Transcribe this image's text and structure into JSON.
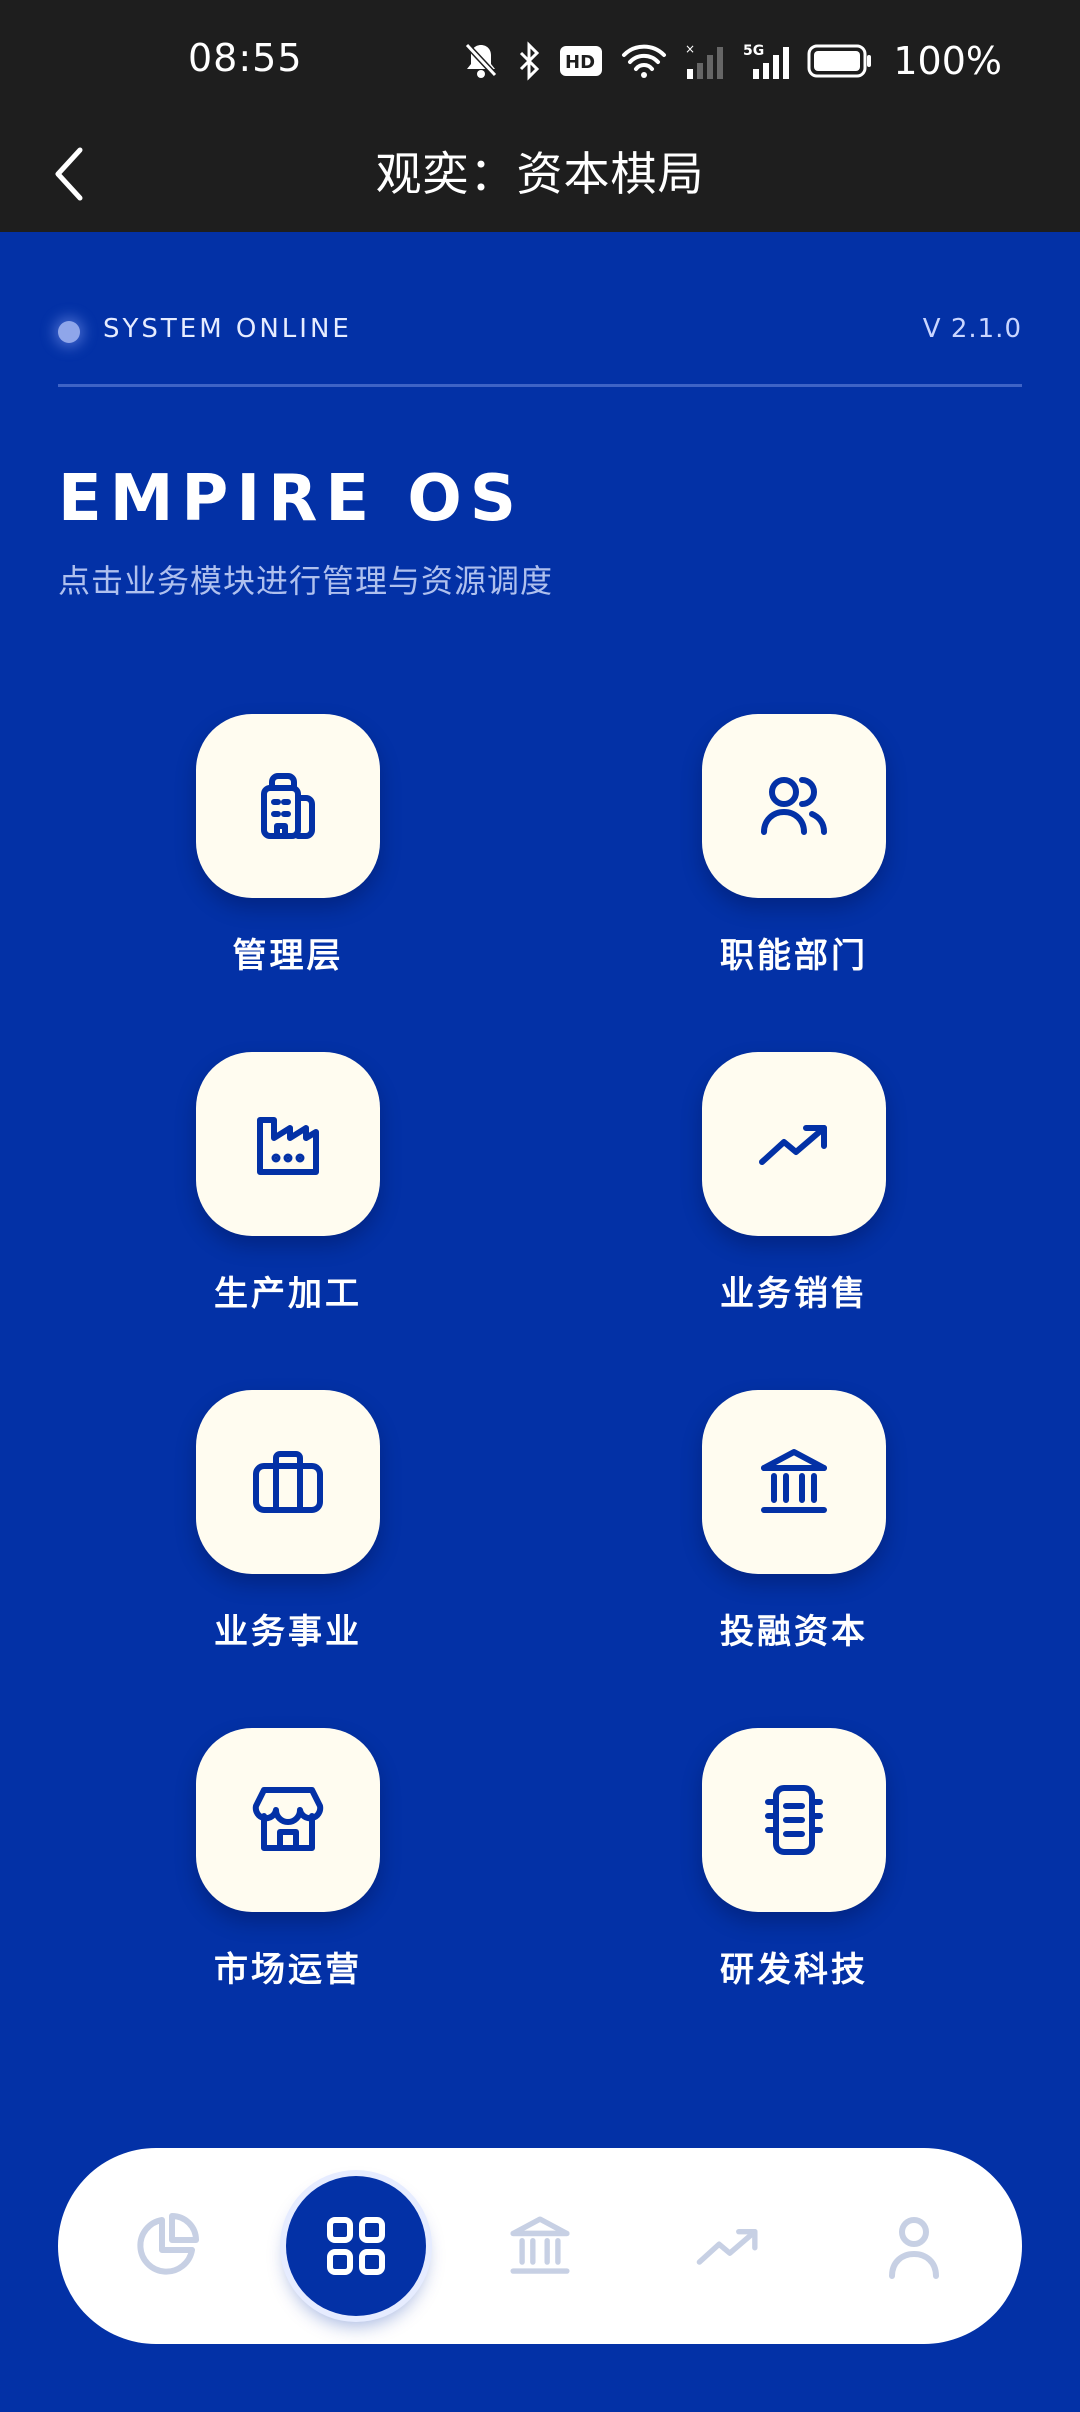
{
  "status_bar": {
    "time": "08:55",
    "battery": "100%",
    "icons": [
      "bell-muted-icon",
      "bluetooth-icon",
      "hd-icon",
      "wifi-icon",
      "signal-weak-icon",
      "signal-5g-icon",
      "battery-icon"
    ]
  },
  "header": {
    "title": "观奕：资本棋局",
    "back_icon": "chevron-left-icon"
  },
  "system": {
    "status": "SYSTEM ONLINE",
    "version": "V 2.1.0"
  },
  "main": {
    "title": "EMPIRE OS",
    "subtitle": "点击业务模块进行管理与资源调度",
    "modules": [
      {
        "label": "管理层",
        "icon": "building-icon"
      },
      {
        "label": "职能部门",
        "icon": "users-icon"
      },
      {
        "label": "生产加工",
        "icon": "factory-icon"
      },
      {
        "label": "业务销售",
        "icon": "trending-up-icon"
      },
      {
        "label": "业务事业",
        "icon": "briefcase-icon"
      },
      {
        "label": "投融资本",
        "icon": "bank-icon"
      },
      {
        "label": "市场运营",
        "icon": "store-icon"
      },
      {
        "label": "研发科技",
        "icon": "chip-icon"
      }
    ]
  },
  "bottom_nav": {
    "items": [
      {
        "icon": "pie-chart-icon",
        "active": false
      },
      {
        "icon": "grid-icon",
        "active": true
      },
      {
        "icon": "bank-icon",
        "active": false
      },
      {
        "icon": "trending-up-icon",
        "active": false
      },
      {
        "icon": "user-icon",
        "active": false
      }
    ]
  },
  "colors": {
    "background": "#0331A6",
    "topbar": "#1E1E1E",
    "tile": "#FFFCF0",
    "icon": "#0331A6",
    "nav_inactive": "#C7D0E4"
  }
}
